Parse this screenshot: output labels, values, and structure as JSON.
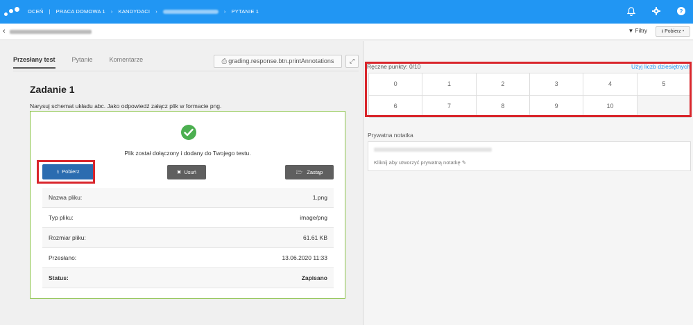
{
  "nav": {
    "crumbs": [
      "OCEŃ",
      "PRACA DOMOWA 1",
      "KANDYDACI",
      "PYTANIE 1"
    ]
  },
  "subheader": {
    "filters_label": "Filtry",
    "download_label": "Pobierz"
  },
  "tabs": {
    "submitted": "Przesłany test",
    "question": "Pytanie",
    "comments": "Komentarze"
  },
  "print_button": "grading.response.btn.printAnnotations",
  "task": {
    "title": "Zadanie 1",
    "description": "Narysuj schemat układu abc. Jako odpowiedź załącz plik w formacie png."
  },
  "file": {
    "message": "Plik został dołączony i dodany do Twojego testu.",
    "download_btn": "Pobierz",
    "delete_btn": "Usuń",
    "replace_btn": "Zastąp",
    "rows": [
      {
        "label": "Nazwa pliku:",
        "value": "1.png"
      },
      {
        "label": "Typ pliku:",
        "value": "image/png"
      },
      {
        "label": "Rozmiar pliku:",
        "value": "61.61 KB"
      },
      {
        "label": "Przesłano:",
        "value": "13.06.2020 11:33"
      },
      {
        "label": "Status:",
        "value": "Zapisano"
      }
    ]
  },
  "grading": {
    "points_label": "Ręczne punkty: 0/10",
    "decimal_link": "Użyj liczb dziesiętnych",
    "points": [
      "0",
      "1",
      "2",
      "3",
      "4",
      "5",
      "6",
      "7",
      "8",
      "9",
      "10"
    ]
  },
  "note": {
    "label": "Prywatna notatka",
    "hint": "Kliknij aby utworzyć prywatną notatkę"
  },
  "colors": {
    "nav_bg": "#2196f3",
    "primary_btn": "#2b6cb0",
    "secondary_btn": "#5f5f5f",
    "success": "#4caf50",
    "highlight": "#d9262c"
  }
}
